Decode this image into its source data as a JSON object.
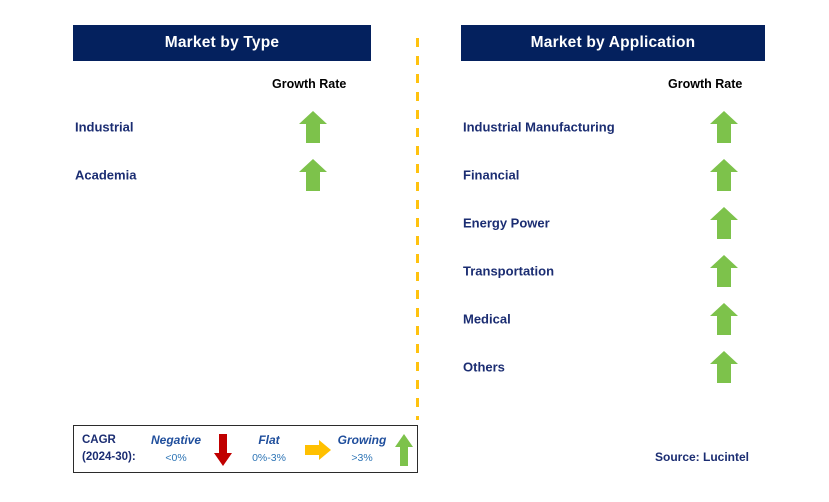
{
  "colors": {
    "header_bg": "#04215E",
    "header_text": "#FFFFFF",
    "label_navy": "#1B2D72",
    "arrow_green": "#7DC24B",
    "arrow_red": "#C00000",
    "arrow_orange": "#FFC000",
    "divider_orange": "#FFC20E",
    "legend_border": "#2B2B2B",
    "legend_value_blue": "#2E75B6",
    "legend_title_blue": "#1F4E9C"
  },
  "panels": [
    {
      "id": "market-by-type",
      "title": "Market by Type",
      "growth_rate_header": "Growth Rate",
      "rows": [
        {
          "label": "Industrial",
          "growth": "growing",
          "icon": "up-arrow-icon"
        },
        {
          "label": "Academia",
          "growth": "growing",
          "icon": "up-arrow-icon"
        }
      ]
    },
    {
      "id": "market-by-application",
      "title": "Market by Application",
      "growth_rate_header": "Growth Rate",
      "rows": [
        {
          "label": "Industrial Manufacturing",
          "growth": "growing",
          "icon": "up-arrow-icon"
        },
        {
          "label": "Financial",
          "growth": "growing",
          "icon": "up-arrow-icon"
        },
        {
          "label": "Energy Power",
          "growth": "growing",
          "icon": "up-arrow-icon"
        },
        {
          "label": "Transportation",
          "growth": "growing",
          "icon": "up-arrow-icon"
        },
        {
          "label": "Medical",
          "growth": "growing",
          "icon": "up-arrow-icon"
        },
        {
          "label": "Others",
          "growth": "growing",
          "icon": "up-arrow-icon"
        }
      ]
    }
  ],
  "legend": {
    "cagr_line1": "CAGR",
    "cagr_line2": "(2024-30):",
    "items": [
      {
        "title": "Negative",
        "value": "<0%",
        "icon": "down-arrow-icon"
      },
      {
        "title": "Flat",
        "value": "0%-3%",
        "icon": "right-arrow-icon"
      },
      {
        "title": "Growing",
        "value": ">3%",
        "icon": "up-arrow-icon"
      }
    ]
  },
  "source": "Source: Lucintel"
}
